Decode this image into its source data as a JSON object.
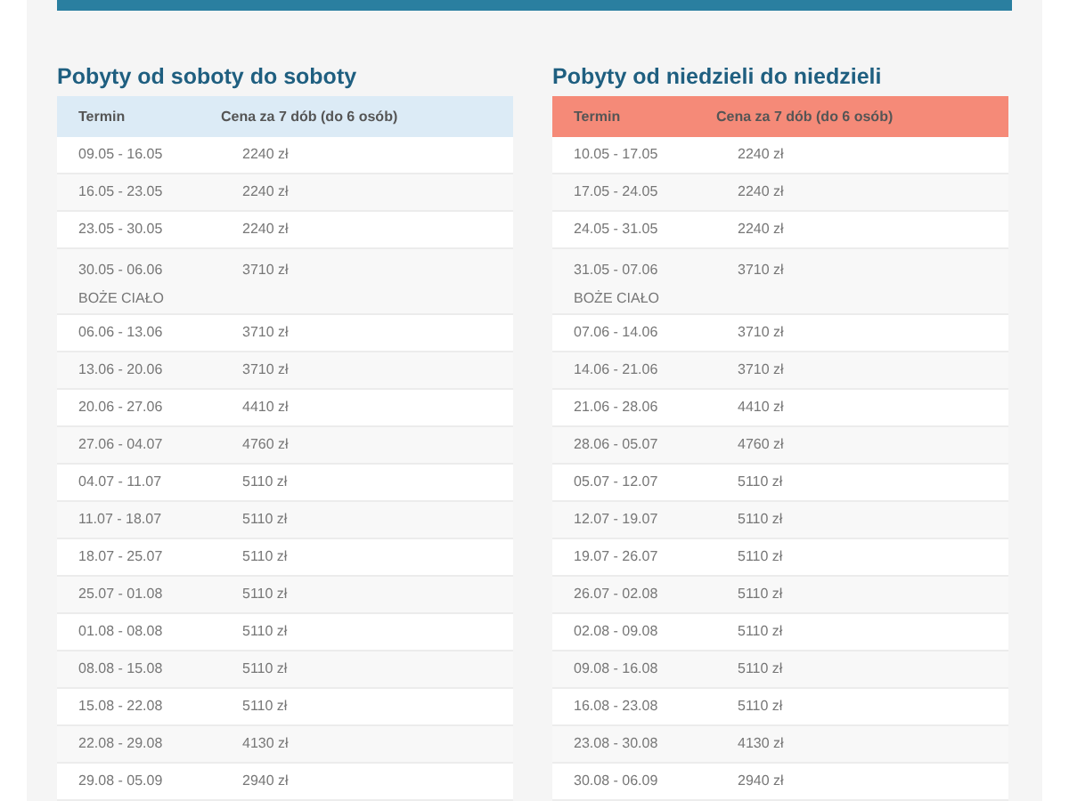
{
  "tables": [
    {
      "title": "Pobyty od soboty do soboty",
      "color": "#dcebf6",
      "columns": [
        "Termin",
        "Cena za 7 dób (do 6 osób)"
      ],
      "rows": [
        {
          "term": "09.05 - 16.05",
          "price": "2240 zł"
        },
        {
          "term": "16.05 - 23.05",
          "price": "2240 zł"
        },
        {
          "term": "23.05 - 30.05",
          "price": "2240 zł"
        },
        {
          "term": "30.05 - 06.06",
          "note": "BOŻE CIAŁO",
          "price": "3710 zł"
        },
        {
          "term": "06.06 - 13.06",
          "price": "3710 zł"
        },
        {
          "term": "13.06 - 20.06",
          "price": "3710 zł"
        },
        {
          "term": "20.06 - 27.06",
          "price": "4410 zł"
        },
        {
          "term": "27.06 - 04.07",
          "price": "4760 zł"
        },
        {
          "term": "04.07 - 11.07",
          "price": "5110 zł"
        },
        {
          "term": "11.07 - 18.07",
          "price": "5110 zł"
        },
        {
          "term": "18.07 - 25.07",
          "price": "5110 zł"
        },
        {
          "term": "25.07 - 01.08",
          "price": "5110 zł"
        },
        {
          "term": "01.08 - 08.08",
          "price": "5110 zł"
        },
        {
          "term": "08.08 - 15.08",
          "price": "5110 zł"
        },
        {
          "term": "15.08 - 22.08",
          "price": "5110 zł"
        },
        {
          "term": "22.08 - 29.08",
          "price": "4130 zł"
        },
        {
          "term": "29.08 - 05.09",
          "price": "2940 zł"
        }
      ]
    },
    {
      "title": "Pobyty od niedzieli do niedzieli",
      "color": "#f58a78",
      "columns": [
        "Termin",
        "Cena za 7 dób (do 6 osób)"
      ],
      "rows": [
        {
          "term": "10.05 - 17.05",
          "price": "2240 zł"
        },
        {
          "term": "17.05 - 24.05",
          "price": "2240 zł"
        },
        {
          "term": "24.05 - 31.05",
          "price": "2240 zł"
        },
        {
          "term": "31.05 - 07.06",
          "note": "BOŻE CIAŁO",
          "price": "3710 zł"
        },
        {
          "term": "07.06 - 14.06",
          "price": "3710 zł"
        },
        {
          "term": "14.06 - 21.06",
          "price": "3710 zł"
        },
        {
          "term": "21.06 - 28.06",
          "price": "4410 zł"
        },
        {
          "term": "28.06 - 05.07",
          "price": "4760 zł"
        },
        {
          "term": "05.07 - 12.07",
          "price": "5110 zł"
        },
        {
          "term": "12.07 - 19.07",
          "price": "5110 zł"
        },
        {
          "term": "19.07 - 26.07",
          "price": "5110 zł"
        },
        {
          "term": "26.07 - 02.08",
          "price": "5110 zł"
        },
        {
          "term": "02.08 - 09.08",
          "price": "5110 zł"
        },
        {
          "term": "09.08 - 16.08",
          "price": "5110 zł"
        },
        {
          "term": "16.08 - 23.08",
          "price": "5110 zł"
        },
        {
          "term": "23.08 - 30.08",
          "price": "4130 zł"
        },
        {
          "term": "30.08 - 06.09",
          "price": "2940 zł"
        }
      ]
    }
  ]
}
